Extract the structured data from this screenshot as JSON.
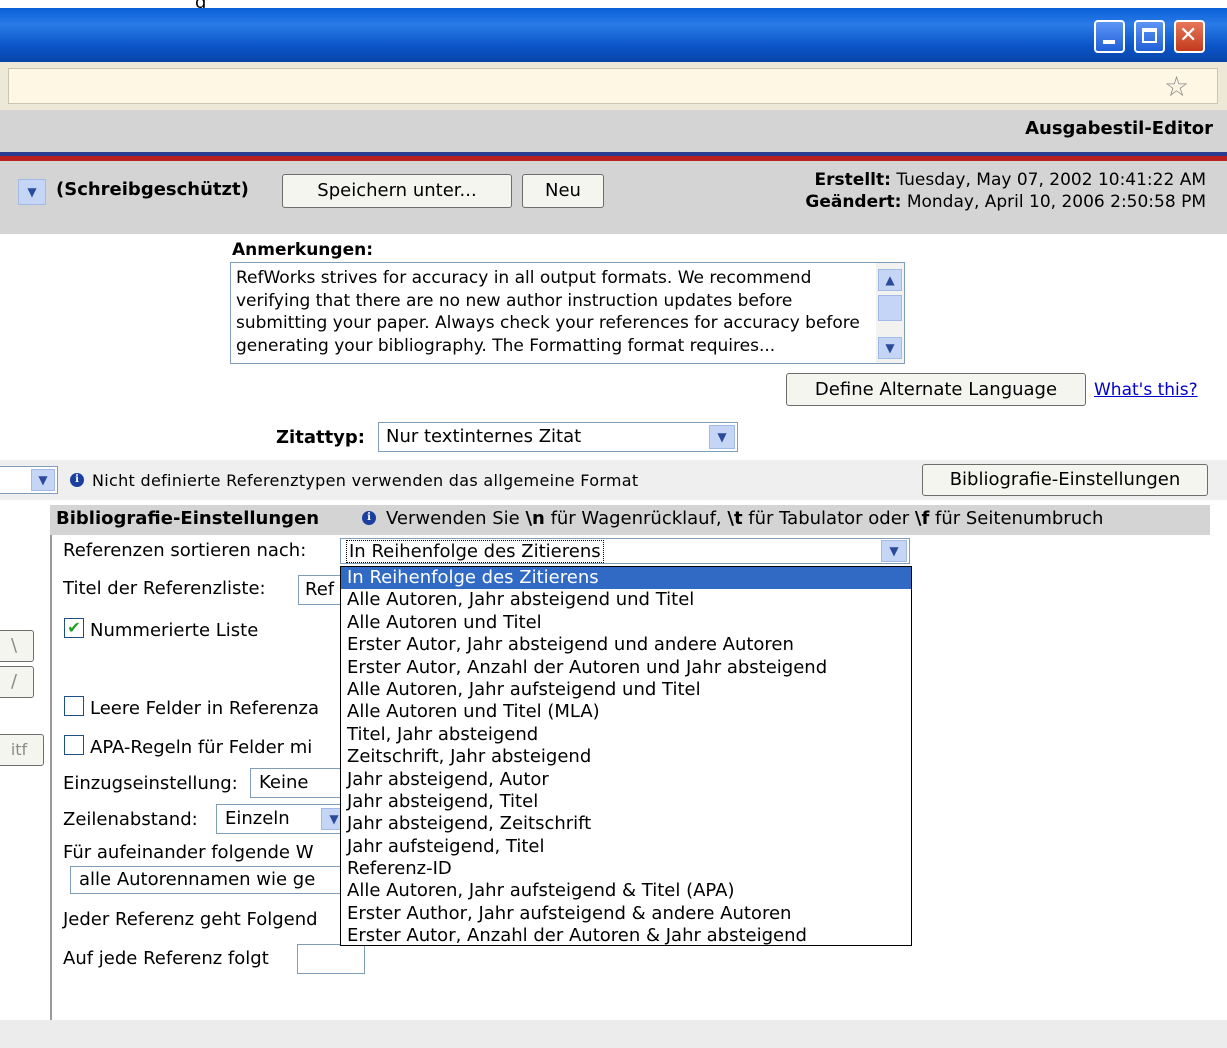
{
  "window": {
    "title_fragment": "g"
  },
  "header": {
    "title": "Ausgabestil-Editor"
  },
  "toolbar": {
    "readonly_label": "(Schreibgeschützt)",
    "save_as_label": "Speichern unter...",
    "new_label": "Neu",
    "created_label": "Erstellt:",
    "created_value": "Tuesday, May 07, 2002 10:41:22 AM",
    "modified_label": "Geändert:",
    "modified_value": "Monday, April 10, 2006 2:50:58 PM"
  },
  "notes": {
    "label": "Anmerkungen:",
    "text": "RefWorks strives for accuracy in all output formats. We recommend verifying that there are no new author instruction updates before submitting your paper. Always check your references for accuracy before generating your bibliography. The Formatting format requires..."
  },
  "language": {
    "define_button": "Define Alternate Language",
    "whats_this": "What's this?"
  },
  "citation": {
    "label": "Zitattyp:",
    "value": "Nur textinternes Zitat"
  },
  "format_bar": {
    "info_text": "Nicht definierte Referenztypen verwenden das allgemeine Format",
    "bib_button": "Bibliografie-Einstellungen"
  },
  "bib_settings": {
    "title": "Bibliografie-Einstellungen",
    "hint_pre": "Verwenden Sie ",
    "hint_n": "\\n",
    "hint_mid1": " für Wagenrücklauf, ",
    "hint_t": "\\t",
    "hint_mid2": " für Tabulator oder ",
    "hint_f": "\\f",
    "hint_post": " für Seitenumbruch",
    "sort_label": "Referenzen sortieren nach:",
    "sort_value": "In Reihenfolge des Zitierens",
    "list_title_label": "Titel der Referenzliste:",
    "list_title_value": "Ref",
    "numbered_label": "Nummerierte Liste",
    "empty_fields_label": "Leere Felder in Referenza",
    "apa_label": "APA-Regeln für Felder mi",
    "indent_label": "Einzugseinstellung:",
    "indent_value": "Keine",
    "spacing_label": "Zeilenabstand:",
    "spacing_value": "Einzeln",
    "consecutive_label": "Für aufeinander folgende W",
    "consecutive_value": "alle Autorennamen wie ge",
    "preceded_label": "Jeder Referenz geht Folgend",
    "followed_label": "Auf jede Referenz folgt"
  },
  "side_buttons": {
    "a": "\\",
    "b": "/",
    "c": "itf"
  },
  "sort_options": [
    "In Reihenfolge des Zitierens",
    "Alle Autoren, Jahr absteigend und Titel",
    "Alle Autoren und Titel",
    "Erster Autor, Jahr absteigend und andere Autoren",
    "Erster Autor, Anzahl der Autoren und Jahr absteigend",
    "Alle Autoren, Jahr aufsteigend und Titel",
    "Alle Autoren und Titel (MLA)",
    "Titel, Jahr absteigend",
    "Zeitschrift, Jahr absteigend",
    "Jahr absteigend, Autor",
    "Jahr absteigend, Titel",
    "Jahr absteigend, Zeitschrift",
    "Jahr aufsteigend, Titel",
    "Referenz-ID",
    "Alle Autoren, Jahr aufsteigend & Titel (APA)",
    "Erster Author, Jahr aufsteigend & andere Autoren",
    "Erster Autor, Anzahl der Autoren & Jahr absteigend"
  ],
  "colors": {
    "titlebar": "#0a5fd6",
    "stripe_blue": "#2b3b8f",
    "stripe_red": "#b91f1f",
    "selection": "#316ac5",
    "link": "#0000cc"
  }
}
